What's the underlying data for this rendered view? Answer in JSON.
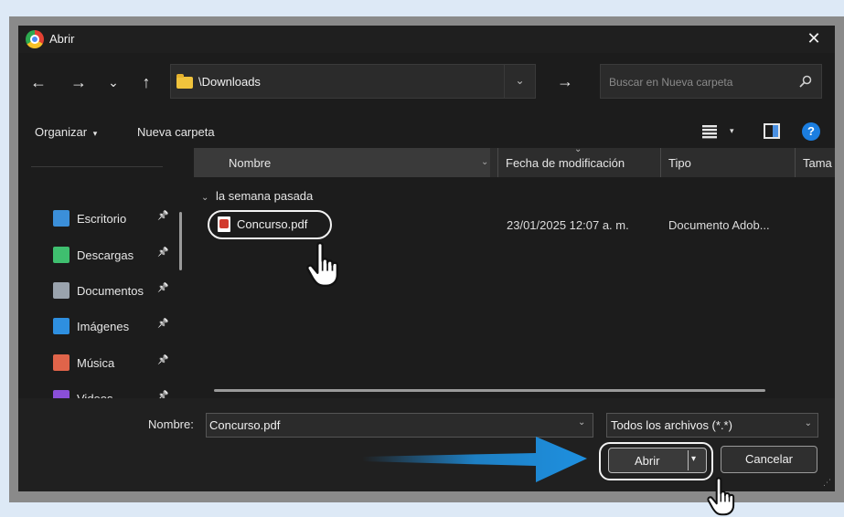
{
  "window": {
    "title": "Abrir",
    "close_glyph": "✕"
  },
  "nav": {
    "back": "←",
    "forward": "→",
    "recent": "⌄",
    "up": "↑",
    "address": "\\Downloads",
    "address_dropdown": "⌄",
    "go": "→",
    "search_placeholder": "Buscar en Nueva carpeta"
  },
  "commands": {
    "organize": "Organizar",
    "organize_caret": "▾",
    "new_folder": "Nueva carpeta",
    "view_caret": "▾",
    "help": "?"
  },
  "sidebar": {
    "items": [
      {
        "label": "Escritorio",
        "icon": "desktop-icon",
        "color": "#3b8fd9"
      },
      {
        "label": "Descargas",
        "icon": "download-icon",
        "color": "#3fbf6f"
      },
      {
        "label": "Documentos",
        "icon": "documents-icon",
        "color": "#9aa3ad"
      },
      {
        "label": "Imágenes",
        "icon": "pictures-icon",
        "color": "#2e8fe0"
      },
      {
        "label": "Música",
        "icon": "music-icon",
        "color": "#e0644a"
      },
      {
        "label": "Videos",
        "icon": "videos-icon",
        "color": "#8a4fd8"
      }
    ],
    "pin_glyph": "📌"
  },
  "list": {
    "columns": {
      "name": "Nombre",
      "modified": "Fecha de modificación",
      "type": "Tipo",
      "size": "Tama"
    },
    "sort_caret": "⌄",
    "group": "la semana pasada",
    "group_caret": "⌄",
    "files": [
      {
        "name": "Concurso.pdf",
        "modified": "23/01/2025 12:07 a. m.",
        "type": "Documento Adob..."
      }
    ]
  },
  "footer": {
    "name_label": "Nombre:",
    "name_value": "Concurso.pdf",
    "name_caret": "⌄",
    "filter": "Todos los archivos (*.*)",
    "filter_caret": "⌄",
    "open": "Abrir",
    "open_caret": "▾",
    "cancel": "Cancelar",
    "grip": "⋰"
  }
}
